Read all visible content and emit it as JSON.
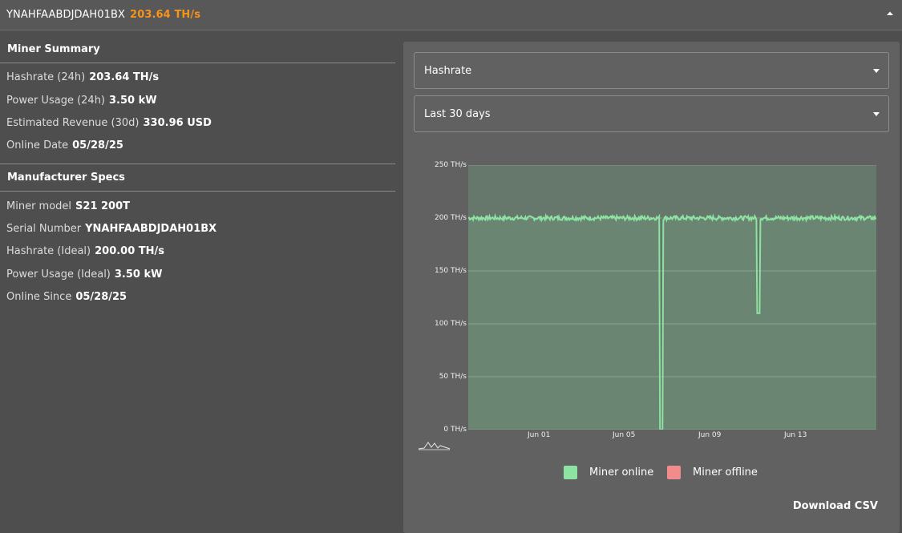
{
  "header": {
    "serial": "YNAHFAABDJDAH01BX",
    "hashrate": "203.64 TH/s",
    "collapse_icon": "chevron-up-icon"
  },
  "summary": {
    "title": "Miner Summary",
    "rows": [
      {
        "label": "Hashrate (24h)",
        "value": "203.64 TH/s"
      },
      {
        "label": "Power Usage (24h)",
        "value": "3.50 kW"
      },
      {
        "label": "Estimated Revenue (30d)",
        "value": "330.96 USD"
      },
      {
        "label": "Online Date",
        "value": "05/28/25"
      }
    ]
  },
  "specs": {
    "title": "Manufacturer Specs",
    "rows": [
      {
        "label": "Miner model",
        "value": "S21 200T"
      },
      {
        "label": "Serial Number",
        "value": "YNAHFAABDJDAH01BX"
      },
      {
        "label": "Hashrate (Ideal)",
        "value": "200.00 TH/s"
      },
      {
        "label": "Power Usage (Ideal)",
        "value": "3.50 kW"
      },
      {
        "label": "Online Since",
        "value": "05/28/25"
      }
    ]
  },
  "controls": {
    "metric_select": "Hashrate",
    "range_select": "Last 30 days"
  },
  "legend": {
    "online": "Miner online",
    "offline": "Miner offline"
  },
  "download_label": "Download CSV",
  "colors": {
    "accent": "#f7931a",
    "online": "#8de3a1",
    "offline": "#f28b8b",
    "plot_bg": "#66786b"
  },
  "chart_data": {
    "type": "area",
    "ylim": [
      0,
      250
    ],
    "yticks": [
      "250 TH/s",
      "200 TH/s",
      "150 TH/s",
      "100 TH/s",
      "50 TH/s",
      "0 TH/s"
    ],
    "xticks": [
      "Jun 01",
      "Jun 05",
      "Jun 09",
      "Jun 13"
    ],
    "x_range": [
      "2025-05-28",
      "2025-06-16"
    ],
    "xtick_dates": [
      "2025-06-01",
      "2025-06-05",
      "2025-06-09",
      "2025-06-13"
    ],
    "baseline": 200,
    "dips": [
      {
        "date": "2025-06-06T00:00",
        "value": 0
      },
      {
        "date": "2025-06-10T12:00",
        "value": 110
      }
    ],
    "series": [
      {
        "values_approx": "approximately 200 TH/s throughout"
      }
    ],
    "grid": true,
    "legend_position": "bottom"
  }
}
